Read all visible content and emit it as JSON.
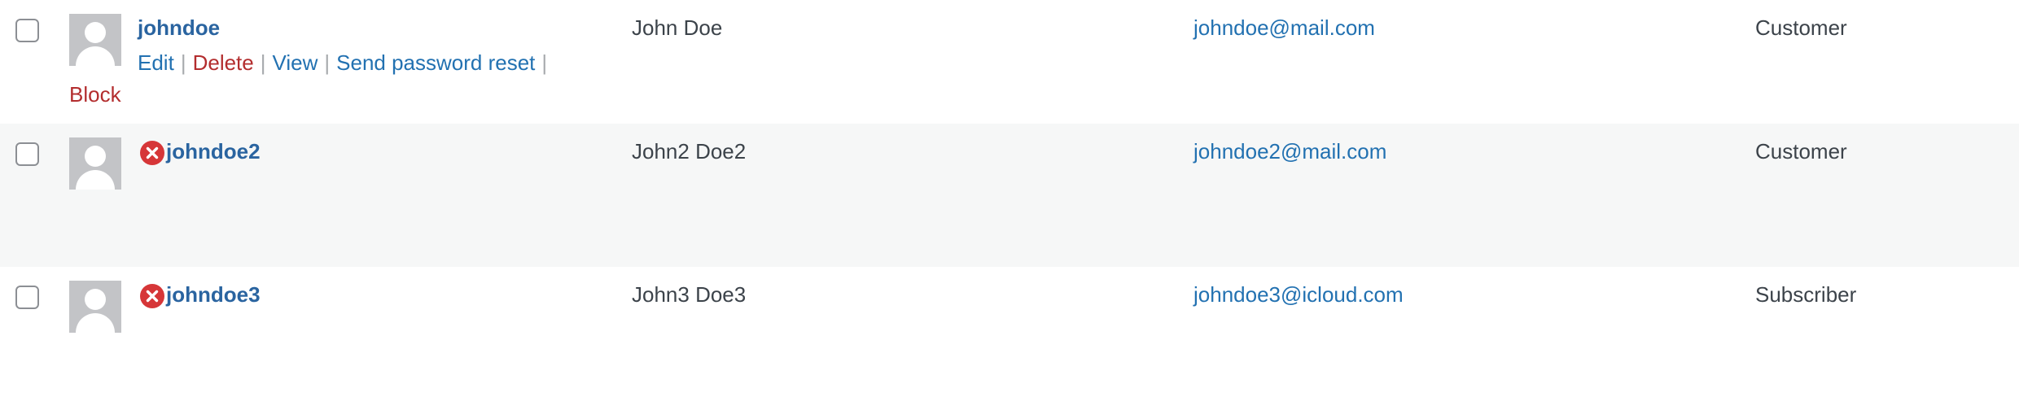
{
  "rows": [
    {
      "username": "johndoe",
      "name": "John Doe",
      "email": "johndoe@mail.com",
      "role": "Customer",
      "blocked": false,
      "actions": {
        "edit": "Edit",
        "delete": "Delete",
        "view": "View",
        "send_password_reset": "Send password reset",
        "block": "Block",
        "separator": "|"
      }
    },
    {
      "username": "johndoe2",
      "name": "John2 Doe2",
      "email": "johndoe2@mail.com",
      "role": "Customer",
      "blocked": true
    },
    {
      "username": "johndoe3",
      "name": "John3 Doe3",
      "email": "johndoe3@icloud.com",
      "role": "Subscriber",
      "blocked": true
    }
  ],
  "icons": {
    "avatar": "default-avatar-icon",
    "blocked": "blocked-x-circle-icon"
  },
  "colors": {
    "link": "#2271b1",
    "username": "#2a64a0",
    "danger": "#b32d2e",
    "blocked_icon": "#d63638",
    "alt_row": "#f6f7f7",
    "text": "#3c434a"
  }
}
